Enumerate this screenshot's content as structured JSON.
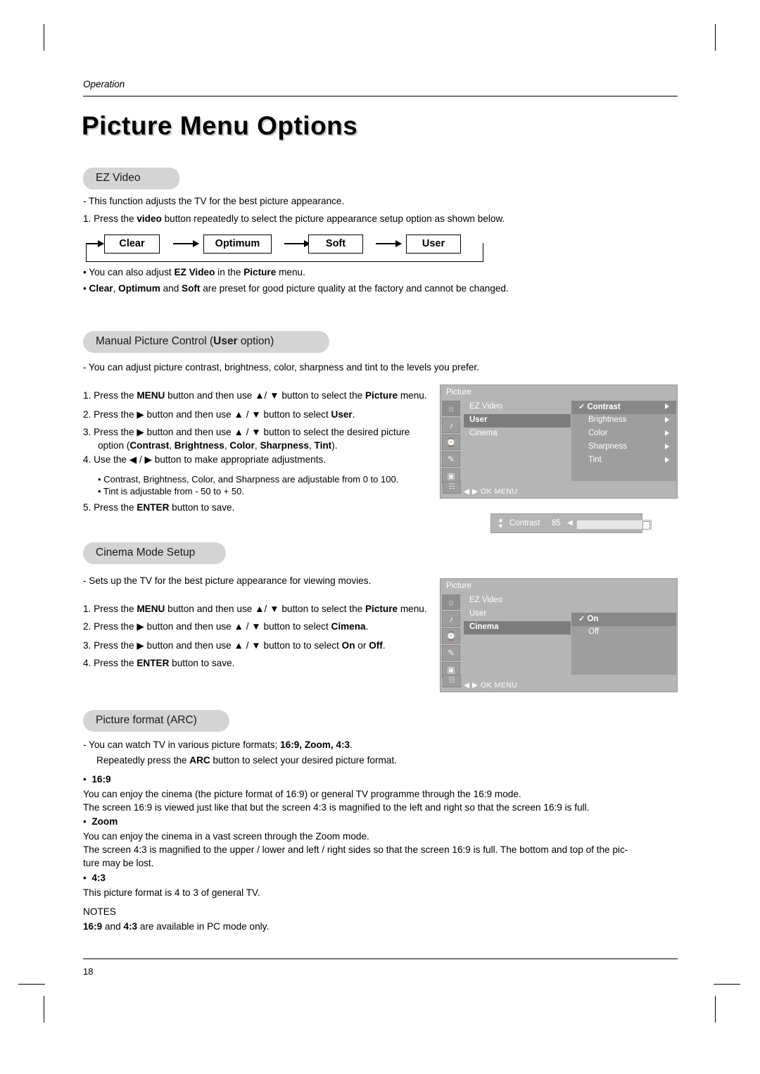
{
  "document": {
    "header_label": "Operation",
    "title": "Picture Menu Options",
    "page_number": "18"
  },
  "sections": {
    "ez_video": {
      "heading": "EZ Video",
      "line1": "-   This function adjusts the TV for the best picture appearance.",
      "line2_pre": "1. Press the ",
      "line2_bold": "video",
      "line2_post": " button repeatedly to select the picture appearance setup option as shown below.",
      "flow": [
        "Clear",
        "Optimum",
        "Soft",
        "User"
      ],
      "note1_pre": "•  You can also adjust ",
      "note1_b1": "EZ Video",
      "note1_mid": " in the ",
      "note1_b2": "Picture",
      "note1_post": " menu.",
      "note2_pre": "•  ",
      "note2_b1": "Clear",
      "note2_s1": ", ",
      "note2_b2": "Optimum",
      "note2_s2": " and ",
      "note2_b3": "Soft",
      "note2_post": " are preset for good picture quality at the factory and cannot be changed."
    },
    "manual_picture": {
      "heading_pre": "Manual Picture Control (",
      "heading_bold": "User",
      "heading_post": " option)",
      "intro": "-   You can adjust picture contrast, brightness, color, sharpness and tint to the levels you prefer.",
      "steps": [
        {
          "num": "1.",
          "parts": [
            "Press the ",
            "MENU",
            " button and then use ▲/ ▼ button to select the ",
            "Picture",
            " menu."
          ]
        },
        {
          "num": "2.",
          "parts": [
            "Press the ▶ button and then use ▲ / ▼ button to select ",
            "User",
            "."
          ]
        },
        {
          "num": "3.",
          "parts": [
            "Press the ▶ button and then use ▲ / ▼ button to select the desired picture"
          ]
        }
      ],
      "step3_cont_pre": "option (",
      "step3_options": [
        "Contrast",
        "Brightness",
        "Color",
        "Sharpness",
        "Tint"
      ],
      "step3_cont_post": ").",
      "step4": "4. Use the ◀ / ▶ button to make appropriate adjustments.",
      "sub_bullets": [
        "• Contrast, Brightness, Color, and Sharpness are adjustable from 0 to 100.",
        "• Tint is adjustable from - 50 to + 50."
      ],
      "step5_pre": "5. Press the ",
      "step5_bold": "ENTER",
      "step5_post": " button to save."
    },
    "cinema_mode": {
      "heading": "Cinema Mode Setup",
      "intro": "-   Sets up the TV for the best picture appearance for viewing movies.",
      "steps": [
        {
          "num": "1.",
          "parts": [
            "Press the ",
            "MENU",
            " button and then use ▲/ ▼ button to select the ",
            "Picture",
            " menu."
          ]
        },
        {
          "num": "2.",
          "parts": [
            "Press the ▶ button and then use ▲ / ▼ button to select ",
            "Cimena",
            "."
          ]
        },
        {
          "num": "3.",
          "parts": [
            "Press the ▶ button and then use ▲ / ▼ button to to select ",
            "On",
            " or ",
            "Off",
            "."
          ]
        },
        {
          "num": "4.",
          "parts": [
            "Press the ",
            "ENTER",
            " button to save."
          ]
        }
      ]
    },
    "picture_format": {
      "heading": "Picture format (ARC)",
      "line1_pre": "-   You can watch TV in various picture formats; ",
      "line1_bold": "16:9, Zoom, 4:3",
      "line1_post": ".",
      "line2_pre": "Repeatedly press the ",
      "line2_bold": "ARC",
      "line2_post": " button to select your desired picture format.",
      "items": [
        {
          "bullet": "16:9",
          "lines": [
            "You can enjoy the cinema (the picture format of 16:9) or general TV programme through the 16:9 mode.",
            "The screen 16:9 is viewed just like that but the screen 4:3 is magnified to the left and right so that the screen 16:9 is full."
          ]
        },
        {
          "bullet": "Zoom",
          "lines": [
            "You can enjoy the cinema in a vast screen through the Zoom mode.",
            "The screen 4:3 is magnified to the upper / lower and left / right sides so that the screen 16:9 is full. The bottom and top of the pic-",
            "ture may be lost."
          ]
        },
        {
          "bullet": "4:3",
          "lines": [
            "This picture format is 4 to 3 of general TV."
          ]
        }
      ],
      "notes_title": "NOTES",
      "notes_b1": "16:9",
      "notes_mid": " and ",
      "notes_b2": "4:3",
      "notes_post": " are available in PC mode only."
    }
  },
  "osd_picture_user": {
    "title": "Picture",
    "left_items": [
      {
        "label": "EZ Video",
        "selected": false
      },
      {
        "label": "User",
        "selected": true
      },
      {
        "label": "Cinema",
        "selected": false
      }
    ],
    "right_items": [
      {
        "label": "Contrast",
        "selected": true,
        "check": "✓"
      },
      {
        "label": "Brightness",
        "selected": false
      },
      {
        "label": "Color",
        "selected": false
      },
      {
        "label": "Sharpness",
        "selected": false
      },
      {
        "label": "Tint",
        "selected": false
      }
    ],
    "footer": "◀ ▶  OK   MENU",
    "icons": [
      "picture-icon",
      "sound-icon",
      "timer-icon",
      "special-icon",
      "screen-icon",
      "pc-icon"
    ]
  },
  "osd_slider": {
    "label": "Contrast",
    "value": "85",
    "fill_percent": 85
  },
  "osd_picture_cinema": {
    "title": "Picture",
    "left_items": [
      {
        "label": "EZ Video",
        "selected": false
      },
      {
        "label": "User",
        "selected": false
      },
      {
        "label": "Cinema",
        "selected": true
      }
    ],
    "right_items": [
      {
        "label": "On",
        "selected": true,
        "check": "✓"
      },
      {
        "label": "Off",
        "selected": false
      }
    ],
    "footer": "◀ ▶  OK   MENU",
    "icons": [
      "picture-icon",
      "sound-icon",
      "timer-icon",
      "special-icon",
      "screen-icon",
      "pc-icon"
    ]
  }
}
